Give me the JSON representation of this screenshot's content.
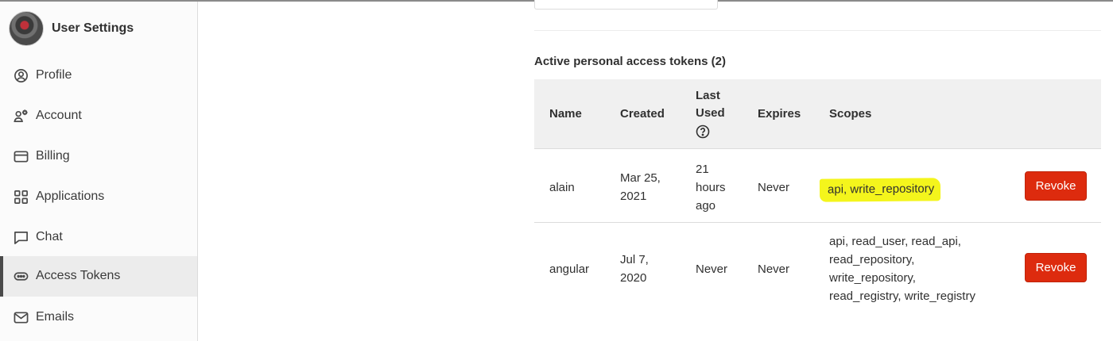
{
  "sidebar": {
    "title": "User Settings",
    "items": [
      {
        "label": "Profile",
        "icon": "profile-icon"
      },
      {
        "label": "Account",
        "icon": "account-icon"
      },
      {
        "label": "Billing",
        "icon": "billing-icon"
      },
      {
        "label": "Applications",
        "icon": "applications-icon"
      },
      {
        "label": "Chat",
        "icon": "chat-icon"
      },
      {
        "label": "Access Tokens",
        "icon": "access-tokens-icon",
        "active": true
      },
      {
        "label": "Emails",
        "icon": "emails-icon"
      }
    ]
  },
  "main": {
    "section_title": "Active personal access tokens (2)",
    "table": {
      "headers": {
        "name": "Name",
        "created": "Created",
        "last_used": "Last Used",
        "expires": "Expires",
        "scopes": "Scopes"
      },
      "rows": [
        {
          "name": "alain",
          "created": "Mar 25, 2021",
          "last_used": "21 hours ago",
          "expires": "Never",
          "scopes": "api, write_repository",
          "scopes_highlighted": true,
          "action": "Revoke"
        },
        {
          "name": "angular",
          "created": "Jul 7, 2020",
          "last_used": "Never",
          "expires": "Never",
          "scopes": "api, read_user, read_api, read_repository, write_repository, read_registry, write_registry",
          "action": "Revoke"
        }
      ]
    }
  },
  "colors": {
    "revoke_button": "#dd2b0e",
    "highlight": "#f4f51c",
    "table_header_bg": "#f0f0f0"
  }
}
